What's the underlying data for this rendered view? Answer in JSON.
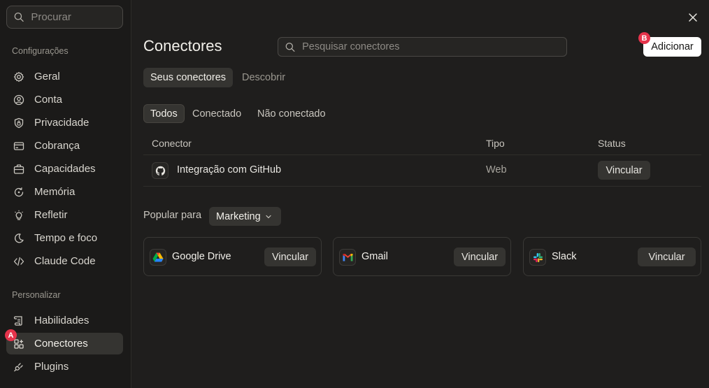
{
  "sidebar": {
    "search_placeholder": "Procurar",
    "section_settings": "Configurações",
    "settings_items": [
      {
        "label": "Geral",
        "icon": "gear-icon"
      },
      {
        "label": "Conta",
        "icon": "user-circle-icon"
      },
      {
        "label": "Privacidade",
        "icon": "shield-lock-icon"
      },
      {
        "label": "Cobrança",
        "icon": "credit-card-icon"
      },
      {
        "label": "Capacidades",
        "icon": "briefcase-icon"
      },
      {
        "label": "Memória",
        "icon": "memory-icon"
      },
      {
        "label": "Refletir",
        "icon": "lightbulb-icon"
      },
      {
        "label": "Tempo e foco",
        "icon": "moon-icon"
      },
      {
        "label": "Claude Code",
        "icon": "code-icon"
      }
    ],
    "section_personalize": "Personalizar",
    "personalize_items": [
      {
        "label": "Habilidades",
        "icon": "scroll-icon"
      },
      {
        "label": "Conectores",
        "icon": "connectors-icon",
        "active": true
      },
      {
        "label": "Plugins",
        "icon": "plug-icon"
      }
    ]
  },
  "annotations": {
    "a": "A",
    "b": "B"
  },
  "header": {
    "title": "Conectores",
    "search_placeholder": "Pesquisar conectores",
    "add_label": "Adicionar"
  },
  "tabs": [
    "Seus conectores",
    "Descobrir"
  ],
  "filters": [
    "Todos",
    "Conectado",
    "Não conectado"
  ],
  "table": {
    "columns": [
      "Conector",
      "Tipo",
      "Status"
    ],
    "rows": [
      {
        "name": "Integração com GitHub",
        "type": "Web",
        "action": "Vincular",
        "icon": "github-icon"
      }
    ]
  },
  "popular": {
    "label": "Popular para",
    "selected": "Marketing",
    "cards": [
      {
        "name": "Google Drive",
        "action": "Vincular",
        "icon": "google-drive-icon"
      },
      {
        "name": "Gmail",
        "action": "Vincular",
        "icon": "gmail-icon"
      },
      {
        "name": "Slack",
        "action": "Vincular",
        "icon": "slack-icon"
      }
    ]
  },
  "colors": {
    "accent_badge": "#e5334b",
    "background": "#1f1e1d",
    "sidebar": "#1b1a19"
  }
}
